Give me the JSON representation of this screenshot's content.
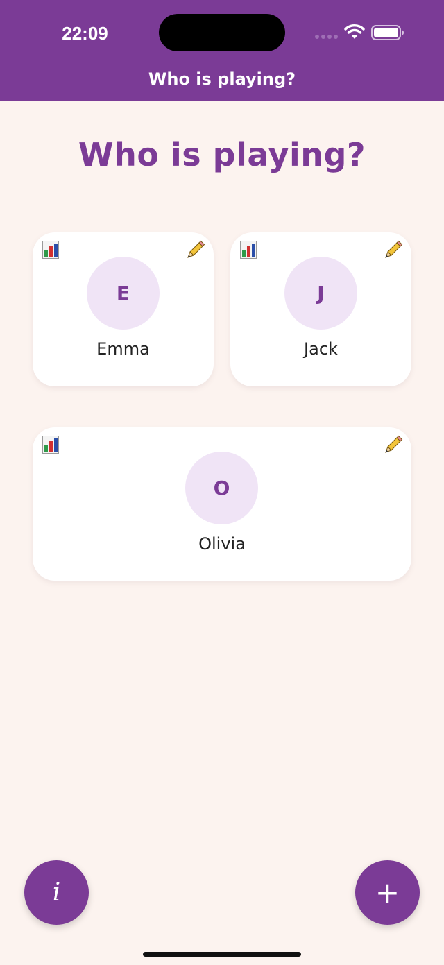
{
  "status_bar": {
    "time": "22:09"
  },
  "header": {
    "title": "Who is playing?"
  },
  "page": {
    "title": "Who is playing?"
  },
  "players": [
    {
      "initial": "E",
      "name": "Emma"
    },
    {
      "initial": "J",
      "name": "Jack"
    },
    {
      "initial": "O",
      "name": "Olivia"
    }
  ],
  "buttons": {
    "info_label": "i",
    "add_label": "+"
  },
  "icons": {
    "stats": "bar-chart-icon",
    "edit": "pencil-icon",
    "wifi": "wifi-icon",
    "battery": "battery-icon"
  },
  "colors": {
    "brand_purple": "#7b3b96",
    "background": "#fcf3ef",
    "avatar_bg": "#f0e4f6",
    "card_bg": "#ffffff"
  }
}
